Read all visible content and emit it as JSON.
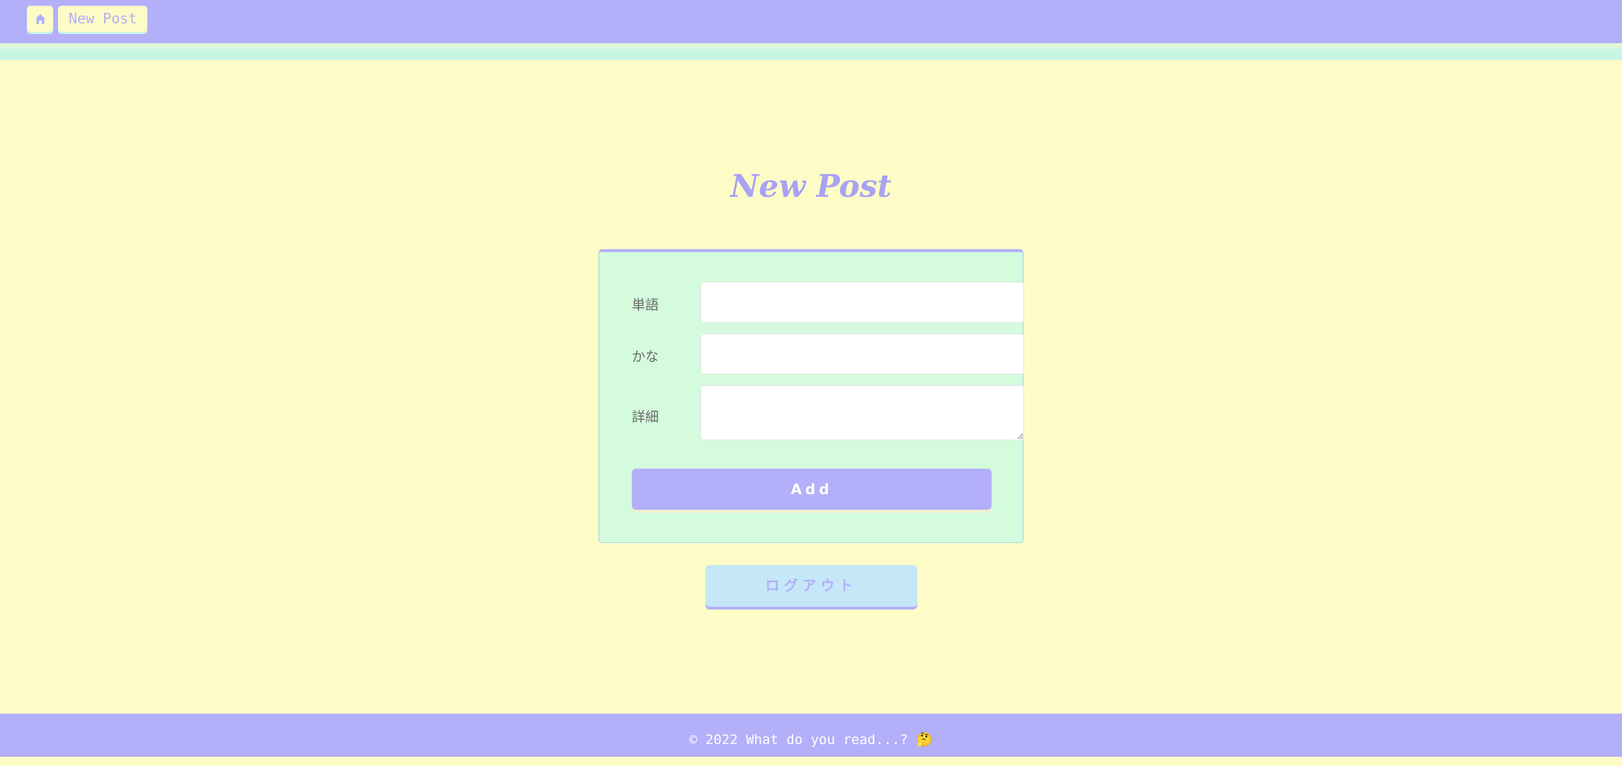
{
  "header": {
    "home_icon": "home-icon",
    "breadcrumb_label": "New Post"
  },
  "page": {
    "title": "New Post"
  },
  "form": {
    "word_label": "単語",
    "word_value": "",
    "kana_label": "かな",
    "kana_value": "",
    "detail_label": "詳細",
    "detail_value": "",
    "submit_label": "Add"
  },
  "logout_label": "ログアウト",
  "footer": {
    "text": "© 2022 What do you read...? 🤔"
  },
  "colors": {
    "accent": "#b3aff9",
    "background": "#fefcc6",
    "card": "#d4fbdd",
    "logout": "#c5e7f8"
  }
}
